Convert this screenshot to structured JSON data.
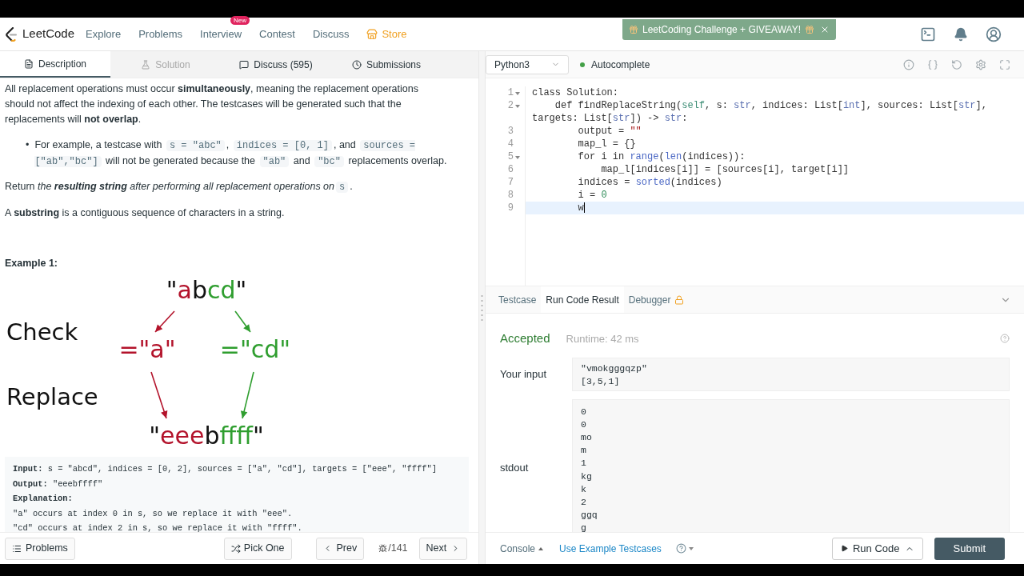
{
  "nav": {
    "brand": "LeetCode",
    "links": [
      {
        "label": "Explore",
        "kind": "plain"
      },
      {
        "label": "Problems",
        "kind": "plain"
      },
      {
        "label": "Interview",
        "kind": "plain",
        "badge": "New"
      },
      {
        "label": "Contest",
        "kind": "plain"
      },
      {
        "label": "Discuss",
        "kind": "plain"
      },
      {
        "label": "Store",
        "kind": "store"
      }
    ],
    "banner": "LeetCoding Challenge + GIVEAWAY!"
  },
  "left_tabs": [
    {
      "label": "Description",
      "selected": true,
      "disabled": false
    },
    {
      "label": "Solution",
      "selected": false,
      "disabled": true
    },
    {
      "label": "Discuss (595)",
      "selected": false,
      "disabled": false
    },
    {
      "label": "Submissions",
      "selected": false,
      "disabled": false
    }
  ],
  "description": [
    {
      "kind": "para",
      "segments": [
        {
          "kind": "plain",
          "text": "All replacement operations must occur **simultaneously**, meaning the replacement operations should not affect the indexing of each other. The testcases will be generated such that the replacements will **not overlap**."
        }
      ]
    },
    {
      "kind": "bullet",
      "bullet": "•",
      "segments": [
        {
          "kind": "plain",
          "text": "For example, a testcase with "
        },
        {
          "kind": "code",
          "text": "s = \"abc\""
        },
        {
          "kind": "plain",
          "text": ", "
        },
        {
          "kind": "code",
          "text": "indices = [0, 1]"
        },
        {
          "kind": "plain",
          "text": ", and "
        },
        {
          "kind": "code",
          "text": "sources = [\"ab\",\"bc\"]"
        },
        {
          "kind": "plain",
          "text": " will not be generated because the "
        },
        {
          "kind": "code",
          "text": "\"ab\""
        },
        {
          "kind": "plain",
          "text": " and "
        },
        {
          "kind": "code",
          "text": "\"bc\""
        },
        {
          "kind": "plain",
          "text": " replacements overlap."
        }
      ]
    },
    {
      "kind": "para",
      "segments": [
        {
          "kind": "plain",
          "text": "Return "
        },
        {
          "kind": "italic",
          "text": "the **resulting string** after performing all replacement operations on"
        },
        {
          "kind": "code",
          "text": "s"
        },
        {
          "kind": "plain",
          "text": "."
        }
      ]
    },
    {
      "kind": "para",
      "segments": [
        {
          "kind": "plain",
          "text": "A **substring** is a contiguous sequence of characters in a string."
        }
      ]
    }
  ],
  "example_title": "Example 1:",
  "figure": {
    "labels": [
      "Check",
      "Replace"
    ],
    "source": [
      {
        "text": "\"",
        "color": "#111111"
      },
      {
        "text": "a",
        "color": "#b3132b"
      },
      {
        "text": "b",
        "color": "#111111"
      },
      {
        "text": "cd",
        "color": "#2f9e2f"
      },
      {
        "text": "\"",
        "color": "#111111"
      }
    ],
    "match_left": [
      {
        "text": "=\"a\"",
        "color": "#b3132b"
      }
    ],
    "match_right": [
      {
        "text": "=\"cd\"",
        "color": "#2f9e2f"
      }
    ],
    "result": [
      {
        "text": "\"",
        "color": "#111111"
      },
      {
        "text": "eee",
        "color": "#b3132b"
      },
      {
        "text": "b",
        "color": "#111111"
      },
      {
        "text": "ffff",
        "color": "#2f9e2f"
      },
      {
        "text": "\"",
        "color": "#111111"
      }
    ]
  },
  "example_lines": [
    "**Input:** s = \"abcd\", indices = [0, 2], sources = [\"a\", \"cd\"], targets = [\"eee\", \"ffff\"]",
    "**Output:** \"eeebffff\"",
    "**Explanation:**",
    "\"a\" occurs at index 0 in s, so we replace it with \"eee\".",
    "\"cd\" occurs at index 2 in s, so we replace it with \"ffff\"."
  ],
  "left_footer": {
    "problems": "Problems",
    "pick": "Pick One",
    "prev": "Prev",
    "counter": "/141",
    "next": "Next"
  },
  "editor": {
    "language": "Python3",
    "autocomplete": "Autocomplete",
    "autocomplete_on": true,
    "lines": [
      {
        "number": "1",
        "fold": true,
        "current": false,
        "tokens": [
          {
            "kind": "plain",
            "text": "class Solution:"
          }
        ]
      },
      {
        "number": "2",
        "fold": true,
        "current": false,
        "tokens": [
          {
            "kind": "plain",
            "text": "    def findReplaceString("
          },
          {
            "kind": "self",
            "text": "self"
          },
          {
            "kind": "plain",
            "text": ", s: "
          },
          {
            "kind": "type",
            "text": "str"
          },
          {
            "kind": "plain",
            "text": ", indices: List["
          },
          {
            "kind": "type",
            "text": "int"
          },
          {
            "kind": "plain",
            "text": "], sources: List["
          },
          {
            "kind": "type",
            "text": "str"
          },
          {
            "kind": "plain",
            "text": "], targets: List["
          },
          {
            "kind": "type",
            "text": "str"
          },
          {
            "kind": "plain",
            "text": "]) -> "
          },
          {
            "kind": "type",
            "text": "str"
          },
          {
            "kind": "plain",
            "text": ":"
          }
        ]
      },
      {
        "number": "3",
        "fold": false,
        "current": false,
        "tokens": [
          {
            "kind": "plain",
            "text": "        output = "
          },
          {
            "kind": "string",
            "text": "\"\""
          }
        ]
      },
      {
        "number": "4",
        "fold": false,
        "current": false,
        "tokens": [
          {
            "kind": "plain",
            "text": "        map_l = {}"
          }
        ]
      },
      {
        "number": "5",
        "fold": true,
        "current": false,
        "tokens": [
          {
            "kind": "plain",
            "text": "        for i in "
          },
          {
            "kind": "builtin",
            "text": "range"
          },
          {
            "kind": "plain",
            "text": "("
          },
          {
            "kind": "builtin",
            "text": "len"
          },
          {
            "kind": "plain",
            "text": "(indices)):"
          }
        ]
      },
      {
        "number": "6",
        "fold": false,
        "current": false,
        "tokens": [
          {
            "kind": "plain",
            "text": "            map_l[indices[i]] = [sources[i], target[i]]"
          }
        ]
      },
      {
        "number": "7",
        "fold": false,
        "current": false,
        "tokens": [
          {
            "kind": "plain",
            "text": "        indices = "
          },
          {
            "kind": "builtin",
            "text": "sorted"
          },
          {
            "kind": "plain",
            "text": "(indices)"
          }
        ]
      },
      {
        "number": "8",
        "fold": false,
        "current": false,
        "tokens": [
          {
            "kind": "plain",
            "text": "        i = "
          },
          {
            "kind": "number",
            "text": "0"
          }
        ]
      },
      {
        "number": "9",
        "fold": false,
        "current": true,
        "tokens": [
          {
            "kind": "plain",
            "text": "        w"
          }
        ]
      }
    ]
  },
  "result_tabs": [
    {
      "label": "Testcase",
      "selected": false,
      "locked": false
    },
    {
      "label": "Run Code Result",
      "selected": true,
      "locked": false
    },
    {
      "label": "Debugger",
      "selected": false,
      "locked": true
    }
  ],
  "result": {
    "status": "Accepted",
    "runtime": "Runtime: 42 ms",
    "input_label": "Your input",
    "input_lines": [
      "\"vmokgggqzp\"",
      "[3,5,1]"
    ],
    "stdout_label": "stdout",
    "stdout_lines": [
      "0",
      "0",
      "mo",
      "m",
      "1",
      "kg",
      "k",
      "2",
      "ggq",
      "g"
    ]
  },
  "right_footer": {
    "console": "Console",
    "example": "Use Example Testcases",
    "run": "Run Code",
    "submit": "Submit"
  }
}
